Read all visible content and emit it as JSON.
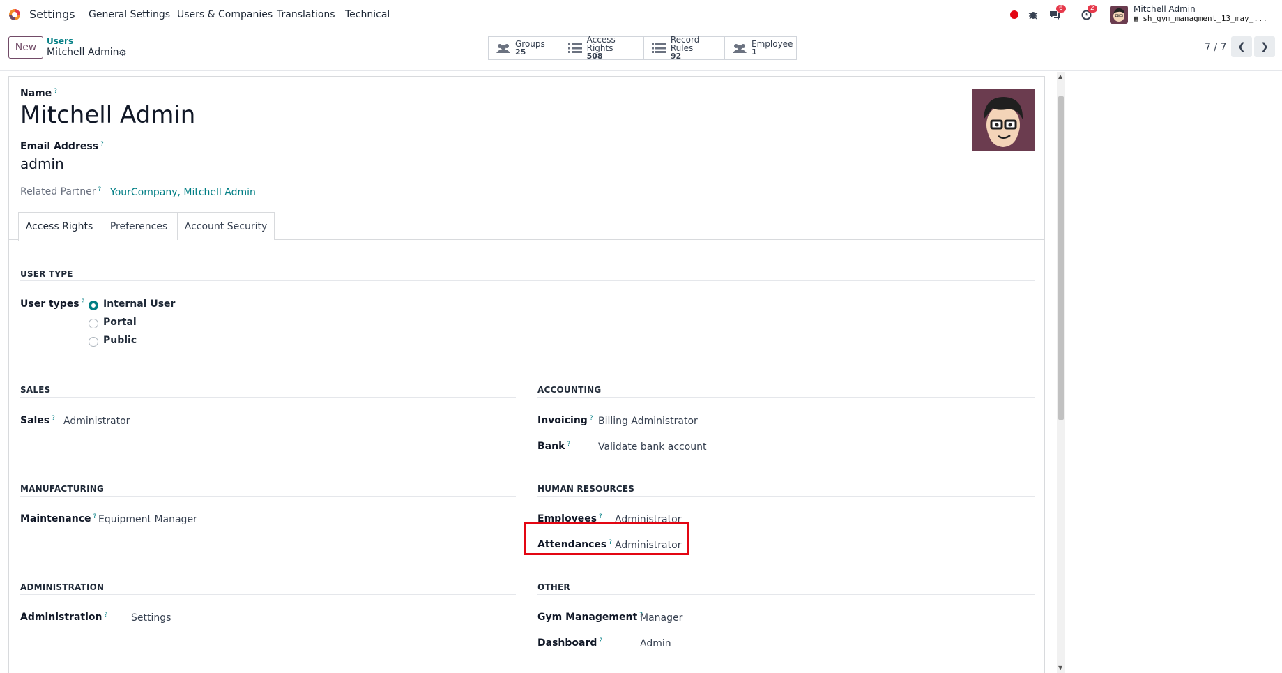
{
  "topbar": {
    "app_name": "Settings",
    "menus": [
      "General Settings",
      "Users & Companies",
      "Translations",
      "Technical"
    ],
    "messages_count": "6",
    "activities_count": "2",
    "user_name": "Mitchell Admin",
    "database": "sh_gym_managment_13_may_..."
  },
  "control_panel": {
    "new_label": "New",
    "breadcrumb_parent": "Users",
    "breadcrumb_current": "Mitchell Admin",
    "smart_buttons": [
      {
        "label": "Groups",
        "value": "25",
        "icon": "users-icon"
      },
      {
        "label": "Access Rights",
        "value": "508",
        "icon": "list-icon"
      },
      {
        "label": "Record Rules",
        "value": "92",
        "icon": "list-icon"
      },
      {
        "label": "Employee",
        "value": "1",
        "icon": "users-icon"
      }
    ],
    "pager": "7 / 7"
  },
  "form": {
    "name_label": "Name",
    "name_value": "Mitchell Admin",
    "email_label": "Email Address",
    "email_value": "admin",
    "partner_label": "Related Partner",
    "partner_value": "YourCompany, Mitchell Admin",
    "tabs": [
      "Access Rights",
      "Preferences",
      "Account Security"
    ],
    "user_type": {
      "heading": "USER TYPE",
      "label": "User types",
      "options": [
        "Internal User",
        "Portal",
        "Public"
      ],
      "selected": "Internal User"
    },
    "sales": {
      "heading": "SALES",
      "field": "Sales",
      "value": "Administrator"
    },
    "accounting": {
      "heading": "ACCOUNTING",
      "invoicing_label": "Invoicing",
      "invoicing_value": "Billing Administrator",
      "bank_label": "Bank",
      "bank_value": "Validate bank account"
    },
    "manufacturing": {
      "heading": "MANUFACTURING",
      "field": "Maintenance",
      "value": "Equipment Manager"
    },
    "hr": {
      "heading": "HUMAN RESOURCES",
      "employees_label": "Employees",
      "employees_value": "Administrator",
      "attendances_label": "Attendances",
      "attendances_value": "Administrator"
    },
    "administration": {
      "heading": "ADMINISTRATION",
      "field": "Administration",
      "value": "Settings"
    },
    "other": {
      "heading": "OTHER",
      "gym_label": "Gym Management",
      "gym_value": "Manager",
      "dashboard_label": "Dashboard",
      "dashboard_value": "Admin"
    }
  },
  "colors": {
    "brand": "#714b67",
    "link": "#017e84",
    "highlight": "#e30613"
  }
}
